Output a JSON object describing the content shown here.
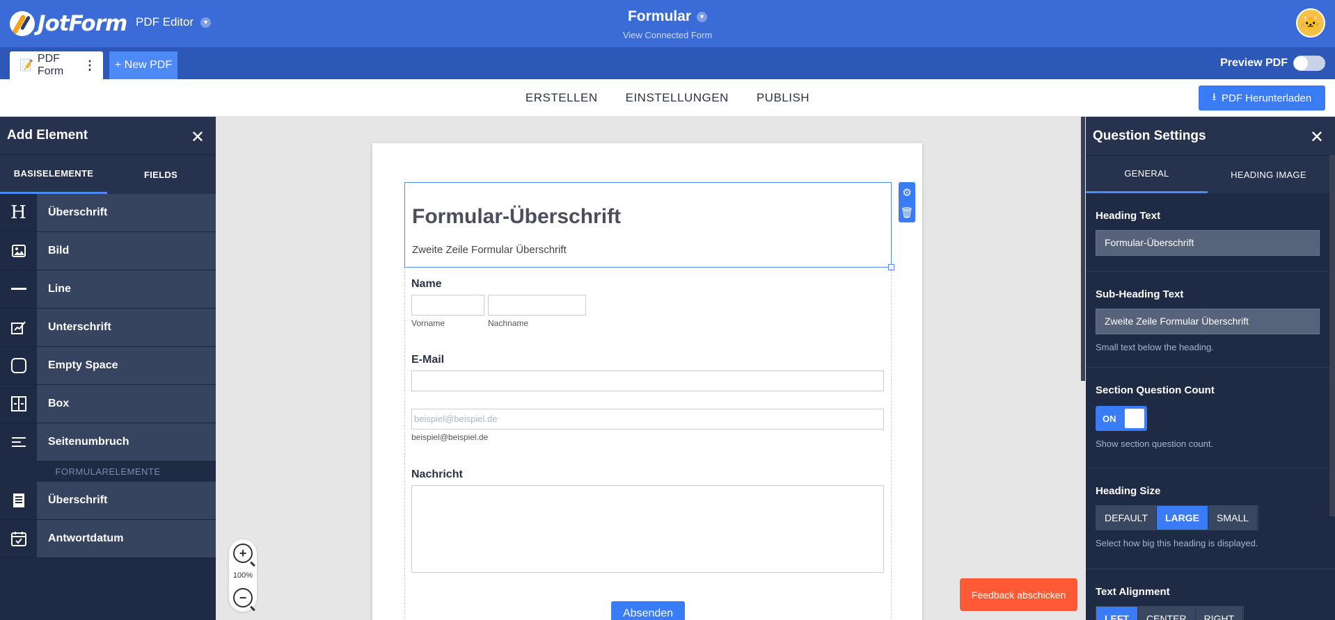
{
  "header": {
    "brand": "JotForm",
    "app_name": "PDF Editor",
    "form_title": "Formular",
    "form_subtitle": "View Connected Form"
  },
  "tabs": {
    "doc_tab": "PDF Form",
    "new_pdf": "+ New PDF",
    "preview_label": "Preview PDF"
  },
  "nav": {
    "items": [
      "ERSTELLEN",
      "EINSTELLUNGEN",
      "PUBLISH"
    ],
    "download": "PDF Herunterladen"
  },
  "left_panel": {
    "title": "Add Element",
    "tabs": [
      "BASISELEMENTE",
      "FIELDS"
    ],
    "basic_items": [
      {
        "icon": "heading-icon",
        "label": "Überschrift"
      },
      {
        "icon": "image-icon",
        "label": "Bild"
      },
      {
        "icon": "line-icon",
        "label": "Line"
      },
      {
        "icon": "signature-icon",
        "label": "Unterschrift"
      },
      {
        "icon": "empty-space-icon",
        "label": "Empty Space"
      },
      {
        "icon": "box-icon",
        "label": "Box"
      },
      {
        "icon": "page-break-icon",
        "label": "Seitenumbruch"
      }
    ],
    "section_label": "FORMULARELEMENTE",
    "form_items": [
      {
        "icon": "document-icon",
        "label": "Überschrift"
      },
      {
        "icon": "calendar-icon",
        "label": "Antwortdatum"
      }
    ]
  },
  "canvas": {
    "heading": "Formular-Überschrift",
    "subheading": "Zweite Zeile Formular Überschrift",
    "name_label": "Name",
    "first_name": "Vorname",
    "last_name": "Nachname",
    "email_label": "E-Mail",
    "email_placeholder": "beispiel@beispiel.de",
    "email_sublabel": "beispiel@beispiel.de",
    "message_label": "Nachricht",
    "submit": "Absenden"
  },
  "zoom": {
    "level": "100%"
  },
  "feedback": "Feedback abschicken",
  "right_panel": {
    "title": "Question Settings",
    "tabs": [
      "GENERAL",
      "HEADING IMAGE"
    ],
    "heading_text_label": "Heading Text",
    "heading_text_value": "Formular-Überschrift",
    "subheading_label": "Sub-Heading Text",
    "subheading_value": "Zweite Zeile Formular Überschrift",
    "subheading_help": "Small text below the heading.",
    "count_label": "Section Question Count",
    "count_toggle": "ON",
    "count_help": "Show section question count.",
    "size_label": "Heading Size",
    "size_options": [
      "DEFAULT",
      "LARGE",
      "SMALL"
    ],
    "size_selected": "LARGE",
    "size_help": "Select how big this heading is displayed.",
    "align_label": "Text Alignment",
    "align_options": [
      "LEFT",
      "CENTER",
      "RIGHT"
    ]
  },
  "colors": {
    "brand_blue": "#3a6bd6",
    "accent": "#3a7cf5",
    "panel_dark": "#1f2a44",
    "feedback": "#ff5a36"
  }
}
